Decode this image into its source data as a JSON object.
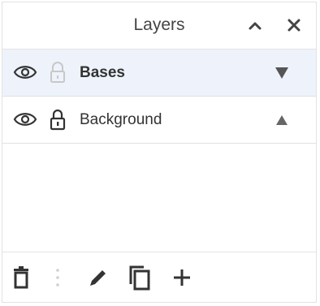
{
  "panel": {
    "title": "Layers",
    "collapse_icon": "chevron-up-icon",
    "close_icon": "close-icon"
  },
  "layers": [
    {
      "name": "Bases",
      "selected": true,
      "visible": true,
      "locked": false,
      "move_icon": "move-down-icon"
    },
    {
      "name": "Background",
      "selected": false,
      "visible": true,
      "locked": true,
      "move_icon": "move-up-icon"
    }
  ],
  "toolbar": {
    "icons": [
      "trash-icon",
      "more-vertical-icon",
      "edit-pencil-icon",
      "duplicate-icon",
      "add-icon"
    ]
  },
  "colors": {
    "selected_row_bg": "#eef3fb",
    "icon": "#444444",
    "icon_faded": "#bbbbbb",
    "border": "#e2e2e2"
  }
}
